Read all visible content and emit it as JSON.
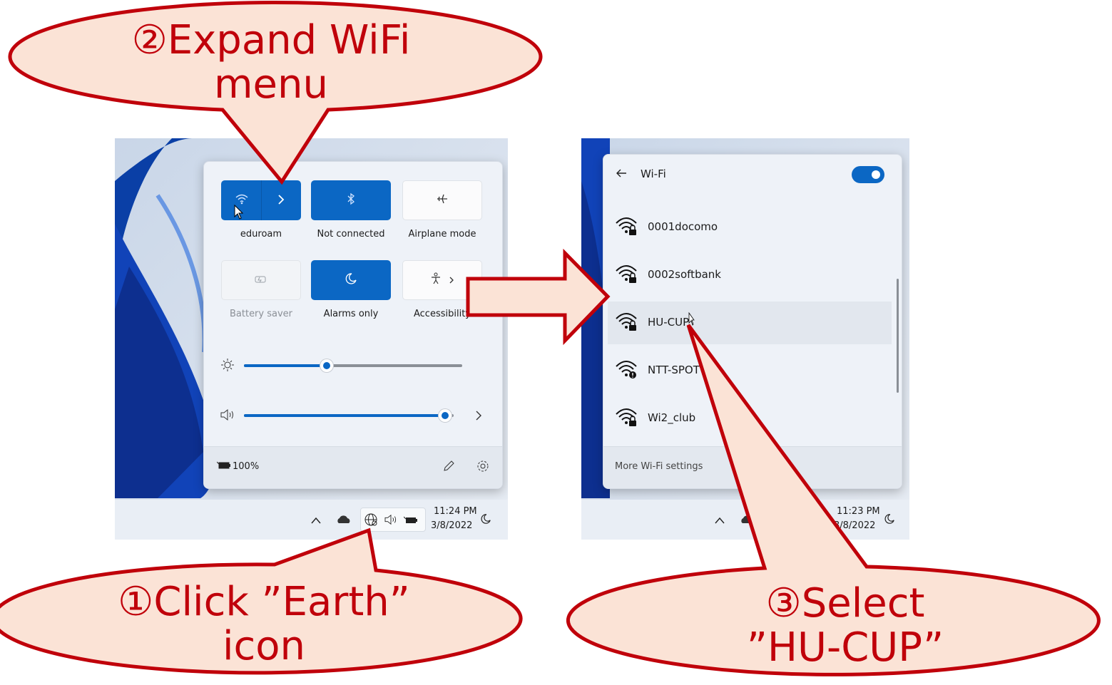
{
  "left_screenshot": {
    "tiles": [
      {
        "label": "eduroam",
        "icon": "wifi-icon",
        "state": "on",
        "has_chevron": true
      },
      {
        "label": "Not connected",
        "icon": "bluetooth-icon",
        "state": "on"
      },
      {
        "label": "Airplane mode",
        "icon": "airplane-icon",
        "state": "off"
      },
      {
        "label": "Battery saver",
        "icon": "battery-saver-icon",
        "state": "disabled"
      },
      {
        "label": "Alarms only",
        "icon": "moon-icon",
        "state": "on"
      },
      {
        "label": "Accessibility",
        "icon": "accessibility-icon",
        "state": "off"
      }
    ],
    "brightness_level": 0.38,
    "volume_level": 0.96,
    "battery_text": "100%",
    "taskbar": {
      "time": "11:24 PM",
      "date": "3/8/2022"
    }
  },
  "right_screenshot": {
    "header": "Wi-Fi",
    "wifi_toggle": "on",
    "networks": [
      "0001docomo",
      "0002softbank",
      "HU-CUP",
      "NTT-SPOT",
      "Wi2_club"
    ],
    "selected_network": "HU-CUP",
    "footer_link": "More Wi-Fi settings",
    "taskbar": {
      "time": "11:23 PM",
      "date": "3/8/2022"
    }
  },
  "callouts": {
    "step1_line1": "①Click ”Earth”",
    "step1_line2": "icon",
    "step2_line1": "②Expand WiFi",
    "step2_line2": "menu",
    "step3_line1": "③Select",
    "step3_line2": "”HU-CUP”"
  },
  "colors": {
    "accent": "#0b67c4",
    "callout_fill": "#fbe3d6",
    "callout_stroke": "#c0000a"
  }
}
